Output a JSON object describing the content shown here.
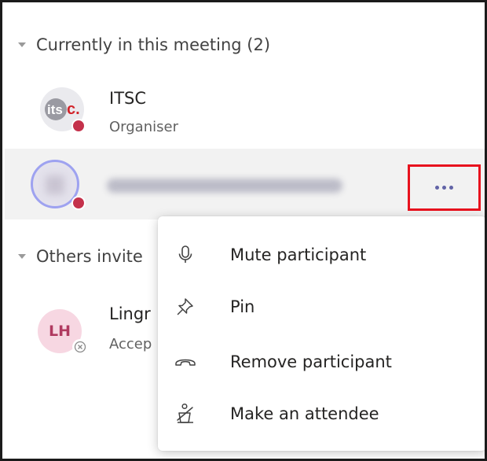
{
  "sections": {
    "current": {
      "label": "Currently in this meeting (2)"
    },
    "others": {
      "label": "Others invite"
    }
  },
  "participants": {
    "organiser": {
      "initials": "itsc.",
      "name": "ITSC",
      "role": "Organiser",
      "status": "busy"
    },
    "selected": {
      "status": "busy"
    },
    "invited": {
      "initials": "LH",
      "name": "Lingr",
      "role": "Accep"
    }
  },
  "context_menu": {
    "items": [
      {
        "label": "Mute participant",
        "icon": "microphone-icon"
      },
      {
        "label": "Pin",
        "icon": "pin-icon"
      },
      {
        "label": "Remove participant",
        "icon": "hang-up-icon"
      },
      {
        "label": "Make an attendee",
        "icon": "attendee-podium-icon"
      }
    ]
  },
  "colors": {
    "accent": "#6264a7",
    "busy": "#c4314b",
    "highlight_border": "#e8121e",
    "row_selected": "#f2f2f2",
    "lh_avatar_bg": "#f7d7e2",
    "lh_avatar_text": "#b03a60"
  }
}
